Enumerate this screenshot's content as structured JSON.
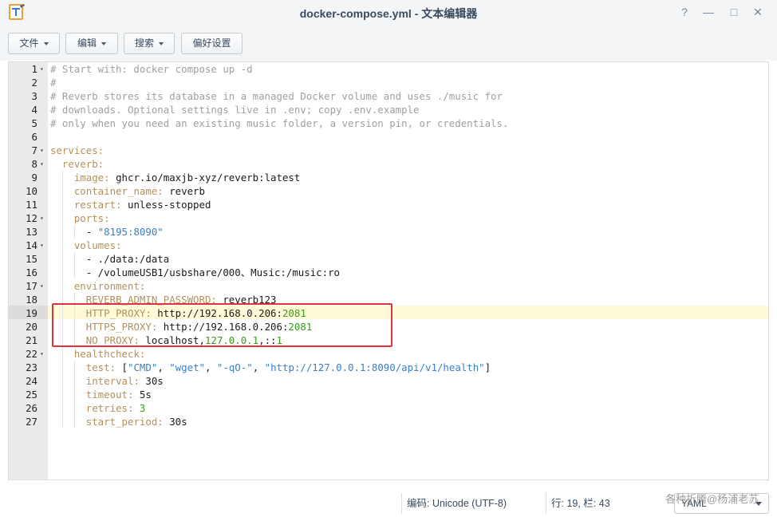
{
  "window": {
    "title": "docker-compose.yml - 文本编辑器",
    "buttons": {
      "help": "?",
      "minimize": "—",
      "maximize": "□",
      "close": "✕"
    }
  },
  "toolbar": {
    "file_label": "文件",
    "edit_label": "编辑",
    "search_label": "搜索",
    "prefs_label": "偏好设置"
  },
  "editor": {
    "lines": [
      {
        "n": "1",
        "fold": true,
        "tokens": [
          {
            "t": "# Start with: docker compose up -d",
            "c": "comment"
          }
        ]
      },
      {
        "n": "2",
        "fold": false,
        "tokens": [
          {
            "t": "#",
            "c": "comment"
          }
        ]
      },
      {
        "n": "3",
        "fold": false,
        "tokens": [
          {
            "t": "# Reverb stores its database in a managed Docker volume and uses ./music for",
            "c": "comment"
          }
        ]
      },
      {
        "n": "4",
        "fold": false,
        "tokens": [
          {
            "t": "# downloads. Optional settings live in .env; copy .env.example",
            "c": "comment"
          }
        ]
      },
      {
        "n": "5",
        "fold": false,
        "tokens": [
          {
            "t": "# only when you need an existing music folder, a version pin, or credentials.",
            "c": "comment"
          }
        ]
      },
      {
        "n": "6",
        "fold": false,
        "tokens": []
      },
      {
        "n": "7",
        "fold": true,
        "tokens": [
          {
            "t": "services:",
            "c": "key"
          }
        ]
      },
      {
        "n": "8",
        "fold": true,
        "tokens": [
          {
            "t": "  ",
            "c": "plain"
          },
          {
            "t": "reverb:",
            "c": "key"
          }
        ]
      },
      {
        "n": "9",
        "fold": false,
        "tokens": [
          {
            "t": "    ",
            "c": "plain"
          },
          {
            "t": "image:",
            "c": "key"
          },
          {
            "t": " ghcr.io/maxjb-xyz/reverb:latest",
            "c": "plain"
          }
        ]
      },
      {
        "n": "10",
        "fold": false,
        "tokens": [
          {
            "t": "    ",
            "c": "plain"
          },
          {
            "t": "container_name:",
            "c": "key"
          },
          {
            "t": " reverb",
            "c": "plain"
          }
        ]
      },
      {
        "n": "11",
        "fold": false,
        "tokens": [
          {
            "t": "    ",
            "c": "plain"
          },
          {
            "t": "restart:",
            "c": "key"
          },
          {
            "t": " unless-stopped",
            "c": "plain"
          }
        ]
      },
      {
        "n": "12",
        "fold": true,
        "tokens": [
          {
            "t": "    ",
            "c": "plain"
          },
          {
            "t": "ports:",
            "c": "key"
          }
        ]
      },
      {
        "n": "13",
        "fold": false,
        "tokens": [
          {
            "t": "      - ",
            "c": "plain"
          },
          {
            "t": "\"8195:8090\"",
            "c": "str"
          }
        ]
      },
      {
        "n": "14",
        "fold": true,
        "tokens": [
          {
            "t": "    ",
            "c": "plain"
          },
          {
            "t": "volumes:",
            "c": "key"
          }
        ]
      },
      {
        "n": "15",
        "fold": false,
        "tokens": [
          {
            "t": "      - ./data:/data",
            "c": "plain"
          }
        ]
      },
      {
        "n": "16",
        "fold": false,
        "tokens": [
          {
            "t": "      - /volumeUSB1/usbshare/000、Music:/music:ro",
            "c": "plain"
          }
        ]
      },
      {
        "n": "17",
        "fold": true,
        "tokens": [
          {
            "t": "    ",
            "c": "plain"
          },
          {
            "t": "environment:",
            "c": "key"
          }
        ]
      },
      {
        "n": "18",
        "fold": false,
        "tokens": [
          {
            "t": "      ",
            "c": "plain"
          },
          {
            "t": "REVERB_ADMIN_PASSWORD:",
            "c": "key"
          },
          {
            "t": " reverb123",
            "c": "plain"
          }
        ]
      },
      {
        "n": "19",
        "fold": false,
        "tokens": [
          {
            "t": "      ",
            "c": "plain"
          },
          {
            "t": "HTTP_PROXY:",
            "c": "key"
          },
          {
            "t": " http://192.168.0.206:",
            "c": "plain"
          },
          {
            "t": "2081",
            "c": "num"
          }
        ]
      },
      {
        "n": "20",
        "fold": false,
        "tokens": [
          {
            "t": "      ",
            "c": "plain"
          },
          {
            "t": "HTTPS_PROXY:",
            "c": "key"
          },
          {
            "t": " http://192.168.0.206:",
            "c": "plain"
          },
          {
            "t": "2081",
            "c": "num"
          }
        ]
      },
      {
        "n": "21",
        "fold": false,
        "tokens": [
          {
            "t": "      ",
            "c": "plain"
          },
          {
            "t": "NO_PROXY:",
            "c": "key"
          },
          {
            "t": " localhost,",
            "c": "plain"
          },
          {
            "t": "127.0.0.1",
            "c": "num"
          },
          {
            "t": ",::",
            "c": "plain"
          },
          {
            "t": "1",
            "c": "num"
          }
        ]
      },
      {
        "n": "22",
        "fold": true,
        "tokens": [
          {
            "t": "    ",
            "c": "plain"
          },
          {
            "t": "healthcheck:",
            "c": "key"
          }
        ]
      },
      {
        "n": "23",
        "fold": false,
        "tokens": [
          {
            "t": "      ",
            "c": "plain"
          },
          {
            "t": "test:",
            "c": "key"
          },
          {
            "t": " [",
            "c": "plain"
          },
          {
            "t": "\"CMD\"",
            "c": "str"
          },
          {
            "t": ", ",
            "c": "plain"
          },
          {
            "t": "\"wget\"",
            "c": "str"
          },
          {
            "t": ", ",
            "c": "plain"
          },
          {
            "t": "\"-qO-\"",
            "c": "str"
          },
          {
            "t": ", ",
            "c": "plain"
          },
          {
            "t": "\"http://127.0.0.1:8090/api/v1/health\"",
            "c": "str"
          },
          {
            "t": "]",
            "c": "plain"
          }
        ]
      },
      {
        "n": "24",
        "fold": false,
        "tokens": [
          {
            "t": "      ",
            "c": "plain"
          },
          {
            "t": "interval:",
            "c": "key"
          },
          {
            "t": " 30s",
            "c": "plain"
          }
        ]
      },
      {
        "n": "25",
        "fold": false,
        "tokens": [
          {
            "t": "      ",
            "c": "plain"
          },
          {
            "t": "timeout:",
            "c": "key"
          },
          {
            "t": " 5s",
            "c": "plain"
          }
        ]
      },
      {
        "n": "26",
        "fold": false,
        "tokens": [
          {
            "t": "      ",
            "c": "plain"
          },
          {
            "t": "retries:",
            "c": "key"
          },
          {
            "t": " ",
            "c": "plain"
          },
          {
            "t": "3",
            "c": "num"
          }
        ]
      },
      {
        "n": "27",
        "fold": false,
        "tokens": [
          {
            "t": "      ",
            "c": "plain"
          },
          {
            "t": "start_period:",
            "c": "key"
          },
          {
            "t": " 30s",
            "c": "plain"
          }
        ]
      }
    ],
    "current_line": "19"
  },
  "status": {
    "encoding": "编码: Unicode (UTF-8)",
    "position": "行: 19, 栏: 43",
    "language": "YAML",
    "watermark": "各种折腾@杨浦老苏"
  },
  "colors": {
    "comment": "#a0a0a0",
    "key": "#b5905c",
    "string": "#3b7fc4",
    "number": "#3a9a1a",
    "highlight": "#e0343a"
  }
}
